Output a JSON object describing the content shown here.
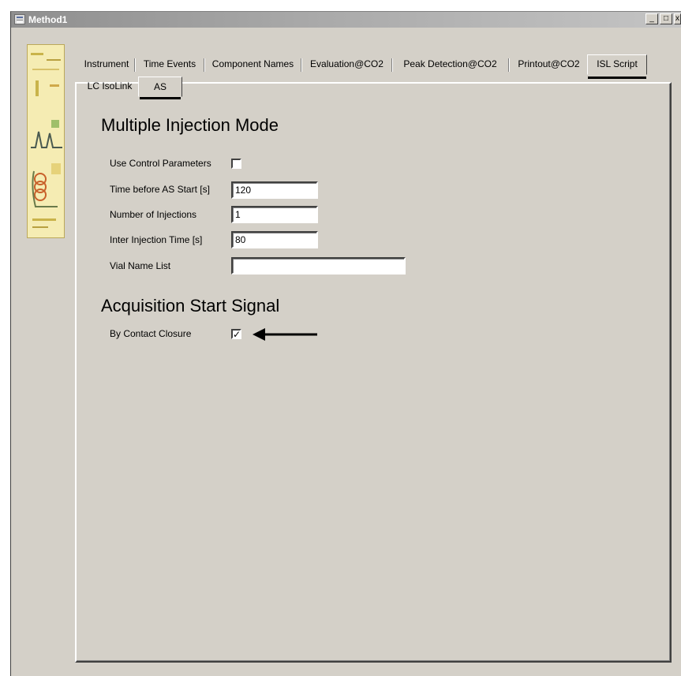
{
  "window": {
    "title": "Method1"
  },
  "title_buttons": {
    "minimize": "_",
    "maximize": "□",
    "close": "x"
  },
  "tabs": [
    {
      "label": "Instrument",
      "active": false
    },
    {
      "label": "Time Events",
      "active": false
    },
    {
      "label": "Component Names",
      "active": false
    },
    {
      "label": "Evaluation@CO2",
      "active": false
    },
    {
      "label": "Peak Detection@CO2",
      "active": false
    },
    {
      "label": "Printout@CO2",
      "active": false
    },
    {
      "label": "ISL Script",
      "active": true
    }
  ],
  "subtabs": [
    {
      "label": "LC IsoLink",
      "active": false
    },
    {
      "label": "AS",
      "active": true
    }
  ],
  "multiple_injection": {
    "heading": "Multiple Injection Mode",
    "use_control_label": "Use Control Parameters",
    "use_control_checked": false,
    "time_before_label": "Time before AS Start [s]",
    "time_before_value": "120",
    "num_injections_label": "Number of Injections",
    "num_injections_value": "1",
    "inter_time_label": "Inter Injection Time [s]",
    "inter_time_value": "80",
    "vial_list_label": "Vial Name List",
    "vial_list_value": ""
  },
  "acquisition": {
    "heading": "Acquisition Start Signal",
    "contact_closure_label": "By Contact Closure",
    "contact_closure_checked": true,
    "check_mark": "✓"
  },
  "colors": {
    "dialog_bg": "#d4d0c8",
    "arrow": "#000000",
    "logo_bg": "#f3e8a6"
  }
}
